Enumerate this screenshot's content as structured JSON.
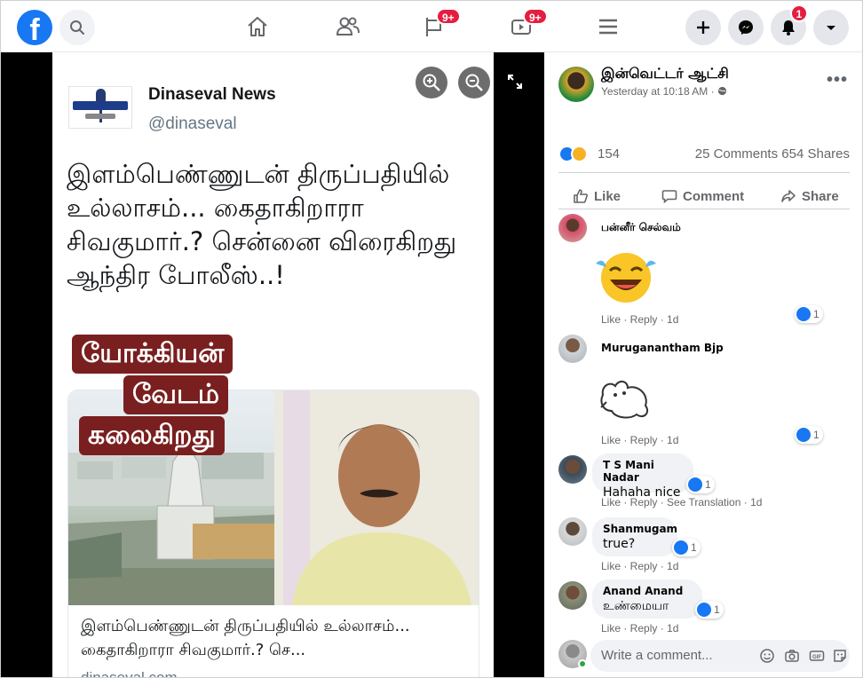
{
  "nav": {
    "logo": "f",
    "watch_badge": "9+",
    "groups_badge": "9+",
    "notifications_badge": "1"
  },
  "viewer": {
    "account_name": "Dinaseval News",
    "account_handle": "@dinaseval",
    "tweet_text": "இளம்பெண்ணுடன் திருப்பதியில் உல்லாசம்... கைதாகிறாரா சிவகுமார்.? சென்னை விரைகிறது ஆந்திர போலீஸ்..!",
    "overlay_lines": [
      "யோக்கியன்",
      "வேடம்",
      "கலைகிறது"
    ],
    "card_description": "இளம்பெண்ணுடன் திருப்பதியில் உல்லாசம்... கைதாகிறாரா சிவகுமார்.? செ...",
    "card_domain": "dinaseval.com"
  },
  "post": {
    "page_name": "இன்வெட்டர் ஆட்சி",
    "time": "Yesterday at 10:18 AM · ",
    "reaction_count": "154",
    "comments_shares": "25 Comments  654 Shares",
    "actions": {
      "like": "Like",
      "comment": "Comment",
      "share": "Share"
    }
  },
  "comments": [
    {
      "name": "பன்னீர் செல்வம்",
      "text": "",
      "meta": "Like · Reply · 1d",
      "likes": "1"
    },
    {
      "name": "Muruganantham Bjp",
      "text": "",
      "meta": "Like · Reply · 1d",
      "likes": "1"
    },
    {
      "name": "T S Mani Nadar",
      "text": "Hahaha nice",
      "meta": "Like · Reply · See Translation · 1d",
      "likes": "1"
    },
    {
      "name": "Shanmugam",
      "text": "true?",
      "meta": "Like · Reply · 1d",
      "likes": "1"
    },
    {
      "name": "Anand Anand",
      "text": "உண்மையா",
      "meta": "Like · Reply · 1d",
      "likes": "1"
    }
  ],
  "write_comment": {
    "placeholder": "Write a comment..."
  },
  "colors": {
    "facebook_blue": "#1877f2",
    "badge_red": "#e41e3f",
    "overlay_maroon": "#7a1f1f"
  }
}
